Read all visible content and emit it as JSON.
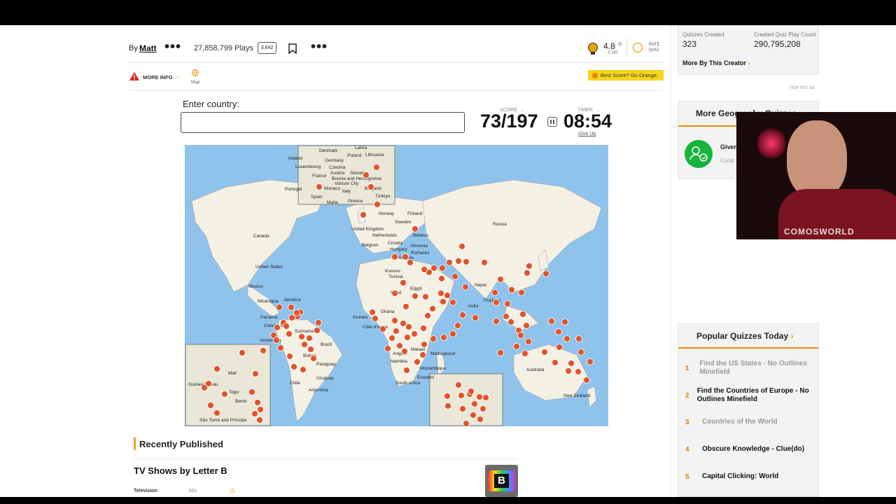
{
  "header": {
    "by_prefix": "By",
    "author": "Matt",
    "plays": "27,858,799 Plays",
    "comments_count": "3,642",
    "rating": "4.8",
    "rating_scale": "/5",
    "rating_count": "7,747",
    "rate_label_1": "RATE",
    "rate_label_2": "QUIZ"
  },
  "toolbar": {
    "more_info": "MORE INFO",
    "map_label": "Map",
    "best_score": "Best Score? Go Orange."
  },
  "quiz": {
    "prompt": "Enter country:",
    "input_value": "",
    "score_label": "SCORE",
    "timer_label": "TIMER",
    "score": "73/197",
    "timer": "08:54",
    "give_up": "Give Up"
  },
  "map_labels": {
    "denmark": "Denmark",
    "latvia": "Latvia",
    "lithuania": "Lithuania",
    "poland": "Poland",
    "ireland": "Ireland",
    "germany": "Germany",
    "luxembourg": "Luxembourg",
    "czechia": "Czechia",
    "slovakia": "Slovakia",
    "france": "France",
    "austria": "Austria",
    "bosnia": "Bosnia and Herzegovina",
    "vatican": "Vatican City",
    "portugal": "Portugal",
    "monaco": "Monaco",
    "italy": "Italy",
    "bulgaria": "Bulgaria",
    "spain": "Spain",
    "turkiye": "Türkiye",
    "malta": "Malta",
    "greece": "Greece",
    "norway": "Norway",
    "finland": "Finland",
    "sweden": "Sweden",
    "russia": "Russia",
    "uk": "United Kingdom",
    "netherlands": "Netherlands",
    "belarus": "Belarus",
    "belgium": "Belgium",
    "croatia": "Croatia",
    "hungary": "Hungary",
    "slovenia": "Slovenia",
    "romania": "Romania",
    "albania": "Albania",
    "kosovo": "Kosovo",
    "tunisia": "Tunisia",
    "canada": "Canada",
    "us": "United States",
    "mexico": "Mexico",
    "jamaica": "Jamaica",
    "nicaragua": "Nicaragua",
    "panama": "Panama",
    "colombia": "Colombia",
    "suriname": "Suriname",
    "venezuela": "Venezuela",
    "brazil": "Brazil",
    "bolivia": "Bolivia",
    "paraguay": "Paraguay",
    "chile": "Chile",
    "uruguay": "Uruguay",
    "argentina": "Argentina",
    "chad": "Chad",
    "egypt": "Egypt",
    "guinea": "Guinea",
    "ghana": "Ghana",
    "cotedivoire": "Côte d'Ivoire",
    "india": "India",
    "nepal": "Nepal",
    "thailand": "Thailand",
    "angola": "Angola",
    "malawi": "Malawi",
    "namibia": "Namibia",
    "madagascar": "Madagascar",
    "mozambique": "Mozambique",
    "eswatini": "Eswatini",
    "southafrica": "South Africa",
    "australia": "Australia",
    "newzealand": "New Zealand",
    "mali": "Mali",
    "guineabissau": "Guinea-Bissau",
    "togo": "Togo",
    "benin": "Benin",
    "saotome": "São Tomé and Príncipe"
  },
  "recent": {
    "heading": "Recently Published",
    "item_title": "TV Shows by Letter B",
    "item_category": "Television",
    "item_time": "60s"
  },
  "sidebar": {
    "quizzes_created_label": "Quizzes Created",
    "quizzes_created": "323",
    "play_count_label": "Created Quiz Play Count",
    "play_count": "290,795,208",
    "more_by_creator": "More By This Creator",
    "hide_ad": "hide this ad",
    "more_geo_heading": "More Geography Quizzes",
    "more_geo_item": "Given",
    "more_geo_sub": "Curat",
    "popular_heading": "Popular Quizzes Today",
    "popular": [
      {
        "num": "1",
        "label": "Find the US States - No Outlines Minefield"
      },
      {
        "num": "2",
        "label": "Find the Countries of Europe - No Outlines Minefield"
      },
      {
        "num": "3",
        "label": "Countries of the World"
      },
      {
        "num": "4",
        "label": "Obscure Knowledge - Clue(do)"
      },
      {
        "num": "5",
        "label": "Capital Clicking: World"
      }
    ]
  },
  "webcam": {
    "shirt_text": "COMOSWORLD"
  },
  "colors": {
    "accent_orange": "#f08c00",
    "badge_yellow": "#f7d51c",
    "ocean": "#8fc3ec",
    "land": "#f4f1e4",
    "pin": "#e0542c"
  }
}
